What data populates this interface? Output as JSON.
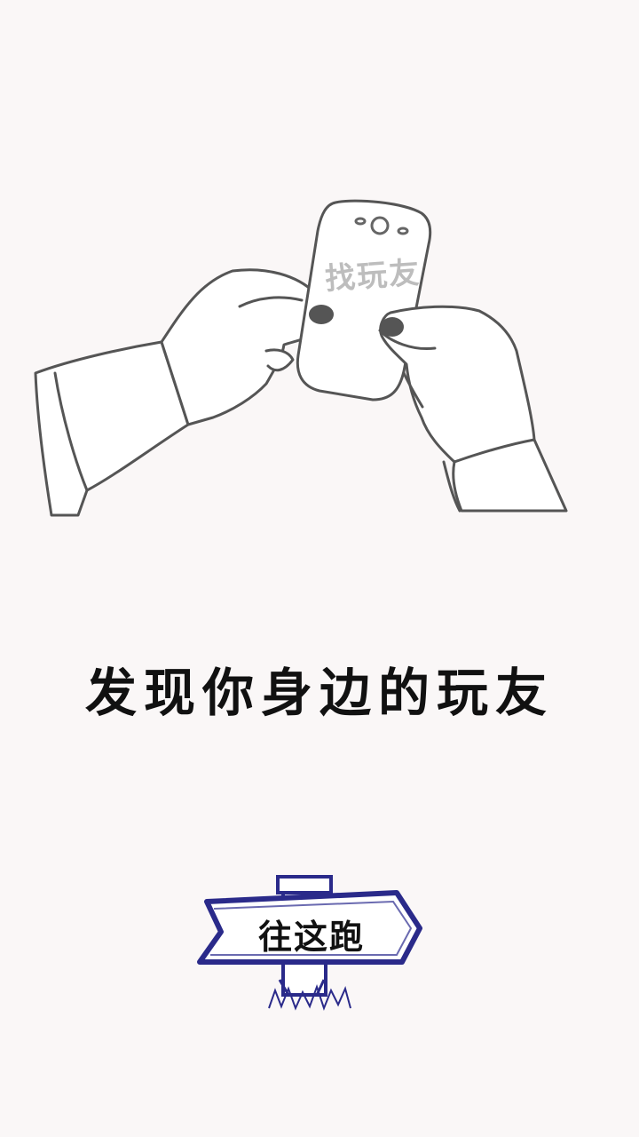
{
  "illustration": {
    "phone_label": "找玩友"
  },
  "intro": {
    "tagline": "发现你身边的玩友"
  },
  "signpost": {
    "label": "往这跑",
    "accent_color": "#2a2a8a"
  },
  "background_color": "#faf7f7"
}
